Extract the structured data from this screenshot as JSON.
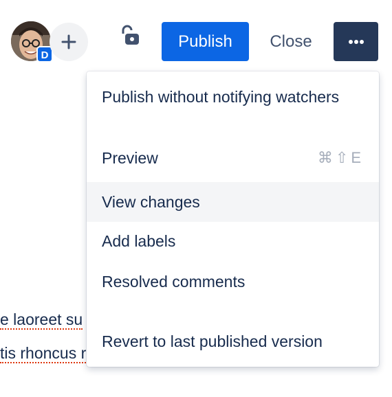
{
  "toolbar": {
    "avatar_badge": "D",
    "publish_label": "Publish",
    "close_label": "Close"
  },
  "editor_lines": [
    {
      "text": "e laoreet su"
    },
    {
      "text": "tis rhoncus r"
    }
  ],
  "menu": {
    "items": [
      {
        "label": "Publish without notifying watchers",
        "shortcut": ""
      },
      {
        "label": "Preview",
        "shortcut": "⌘⇧E"
      },
      {
        "label": "View changes",
        "shortcut": "",
        "state": "hovered"
      },
      {
        "label": "Add labels",
        "shortcut": ""
      },
      {
        "label": "Resolved comments",
        "shortcut": ""
      },
      {
        "label": "Revert to last published version",
        "shortcut": ""
      }
    ]
  },
  "colors": {
    "primary": "#0c66e4",
    "more_button_bg": "#253858",
    "text": "#172b4d",
    "hover_bg": "#f4f5f7",
    "spellcheck": "#de350b"
  }
}
